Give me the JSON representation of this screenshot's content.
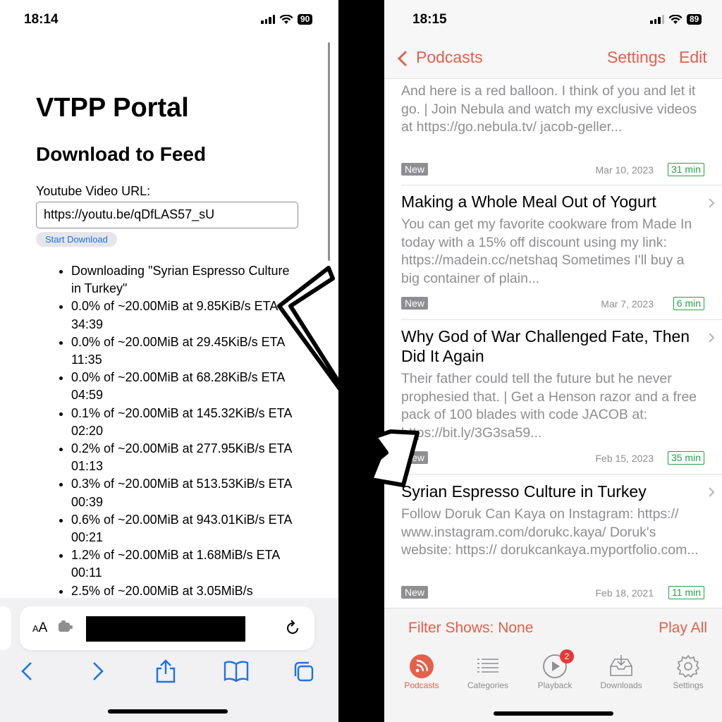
{
  "left": {
    "status": {
      "time": "18:14",
      "battery": "90"
    },
    "page": {
      "title": "VTPP Portal",
      "subtitle": "Download to Feed",
      "url_label": "Youtube Video URL:",
      "url_value": "https://youtu.be/qDfLAS57_sU",
      "start_button": "Start Download",
      "log": [
        "Downloading \"Syrian Espresso Culture in Turkey\"",
        "0.0% of ~20.00MiB at 9.85KiB/s ETA 34:39",
        "0.0% of ~20.00MiB at 29.45KiB/s ETA 11:35",
        "0.0% of ~20.00MiB at 68.28KiB/s ETA 04:59",
        "0.1% of ~20.00MiB at 145.32KiB/s ETA 02:20",
        "0.2% of ~20.00MiB at 277.95KiB/s ETA 01:13",
        "0.3% of ~20.00MiB at 513.53KiB/s ETA 00:39",
        "0.6% of ~20.00MiB at 943.01KiB/s ETA 00:21",
        "1.2% of ~20.00MiB at 1.68MiB/s ETA 00:11",
        "2.5% of ~20.00MiB at 3.05MiB/s"
      ]
    },
    "browser": {
      "aa_label": "AA"
    }
  },
  "right": {
    "status": {
      "time": "18:15",
      "battery": "89"
    },
    "nav": {
      "back": "Podcasts",
      "settings": "Settings",
      "edit": "Edit"
    },
    "episodes": [
      {
        "title": "",
        "description": "And here is a red balloon. I think of you and let it go. | Join Nebula and watch my exclusive videos at https://go.nebula.tv/ jacob-geller...",
        "badge": "New",
        "date": "Mar 10, 2023",
        "duration": "31 min"
      },
      {
        "title": "Making a Whole Meal Out of Yogurt",
        "description": "You can get my favorite cookware from Made In today with a 15% off discount using my link: https://madein.cc/netshaq Sometimes I'll buy a big container of plain...",
        "badge": "New",
        "date": "Mar 7, 2023",
        "duration": "6 min"
      },
      {
        "title": "Why God of War Challenged Fate, Then Did It Again",
        "description": "Their father could tell the future but he never prophesied that. |  Get a Henson razor and a free pack of 100 blades with code JACOB at: https://bit.ly/3G3sa59...",
        "badge": "New",
        "date": "Feb 15, 2023",
        "duration": "35 min"
      },
      {
        "title": "Syrian Espresso Culture in Turkey",
        "description": "Follow Doruk Can Kaya on Instagram: https:// www.instagram.com/dorukc.kaya/ Doruk's website: https:// dorukcankaya.myportfolio.com...",
        "badge": "New",
        "date": "Feb 18, 2021",
        "duration": "11 min"
      }
    ],
    "bottom": {
      "filter": "Filter Shows: None",
      "play_all": "Play All",
      "tabs": [
        "Podcasts",
        "Categories",
        "Playback",
        "Downloads",
        "Settings"
      ],
      "playback_badge": "2"
    }
  },
  "colors": {
    "accent": "#e4604a",
    "duration_green": "#24a148",
    "grey_text": "#8e8e93",
    "link_blue": "#1a73e8"
  }
}
